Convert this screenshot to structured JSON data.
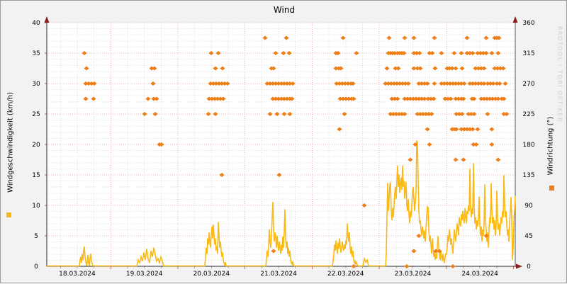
{
  "title": "Wind",
  "watermark": "RRDTOOL / TOBI OETIKER",
  "axes": {
    "left": {
      "label": "Windgeschwindigkeit (km/h)",
      "min": 0,
      "max": 40,
      "ticks": [
        "0",
        "5",
        "10",
        "15",
        "20",
        "25",
        "30",
        "35",
        "40"
      ]
    },
    "right": {
      "label": "Windrichtung (°)",
      "min": 0,
      "max": 360,
      "ticks": [
        "0",
        "45",
        "90",
        "135",
        "180",
        "225",
        "270",
        "315",
        "360"
      ]
    },
    "x": {
      "labels": [
        "18.03.2024",
        "19.03.2024",
        "20.03.2024",
        "21.03.2024",
        "22.03.2024",
        "23.03.2024",
        "24.03.2024"
      ]
    }
  },
  "legend": {
    "speed_marker": "wind-speed",
    "speed_color": "#fbb913",
    "direction_marker": "wind-direction",
    "direction_color": "#ee7e16"
  },
  "colors": {
    "grid_major": "#f2afaf",
    "grid_minor": "#dcdcdc",
    "axis": "#2b2b2b",
    "axis_right": "#555555",
    "arrow": "#8a1d1d",
    "plot_bg": "#ffffff",
    "page_bg": "#f2f2f2",
    "text": "#000000"
  },
  "chart_data": {
    "type": "line+scatter",
    "x_unit": "days since 18.03.2024 00:00",
    "x_range": [
      0.046,
      7.026
    ],
    "ylim_left": [
      0,
      40
    ],
    "ylim_right": [
      0,
      360
    ],
    "grid": "dotted, major every 5 km/h (45 deg) and每 midnight, minor every 1 km/h and 6 h",
    "series": [
      {
        "name": "Windgeschwindigkeit",
        "unit": "km/h",
        "type": "line",
        "color": "#fbb913",
        "segments": [
          {
            "t0": 0.5322,
            "dt": 0.01056,
            "values": [
              0,
              1,
              1.5,
              0.5,
              2,
              1,
              2.5,
              3.2,
              1.5,
              0.8,
              0,
              0.5,
              1.8,
              0.6,
              0,
              1.2,
              2,
              1,
              0.4,
              0
            ]
          },
          {
            "t0": 1.3875,
            "dt": 0.02112,
            "values": [
              0,
              1,
              0.5,
              1.5,
              0.8,
              2.2,
              1,
              2.8,
              1.2,
              0.5,
              2.5,
              1.5,
              3,
              1.8,
              0.8,
              1.2,
              0.5,
              1.5,
              0.8,
              0
            ]
          },
          {
            "t0": 2.4013,
            "dt": 0.01056,
            "values": [
              0,
              1.5,
              3,
              2,
              4.5,
              3.5,
              5.5,
              4,
              3,
              5,
              6.5,
              4.5,
              6.8,
              5,
              3.5,
              4.5,
              2.5,
              3.2,
              2,
              7.2,
              5,
              3,
              4,
              2.5,
              1.5,
              2.2,
              1,
              0.5,
              0.2,
              0.6,
              0
            ]
          },
          {
            "t0": 3.3094,
            "dt": 0.01056,
            "values": [
              0,
              1,
              2.5,
              1.5,
              3,
              6,
              4,
              3,
              5,
              8,
              10.5,
              6,
              4,
              5.5,
              4.5,
              3,
              5,
              3.5,
              2.5,
              4,
              3,
              2,
              3.5,
              2.5,
              4.8,
              3,
              5.5,
              9.3,
              5,
              3,
              4,
              2,
              3,
              1.5,
              2.5,
              1,
              0.5,
              0.3,
              0.8,
              0.2,
              0
            ]
          },
          {
            "t0": 4.302,
            "dt": 0.01056,
            "values": [
              0,
              0.8,
              2,
              3.5,
              2.5,
              4.2,
              3,
              2,
              3.8,
              2.8,
              4.5,
              3.2,
              2.2,
              3,
              4,
              3,
              2.5,
              3.5,
              2.8,
              4.2,
              3.5,
              7,
              5,
              4,
              5.5,
              3,
              2,
              3.2,
              1.5,
              2.5,
              1,
              0.5,
              0.8,
              0.3,
              0.6,
              0.2,
              0
            ]
          },
          {
            "t0": 4.7561,
            "dt": 0.02112,
            "values": [
              0,
              1.2,
              0.6,
              1,
              0
            ]
          },
          {
            "t0": 5.094,
            "dt": 0.01056,
            "values": [
              0,
              2,
              8,
              13.6,
              9,
              11,
              13.4,
              13.6,
              9,
              7.5,
              9.5,
              8,
              10,
              12,
              13,
              11,
              14,
              16.5,
              13,
              15,
              12,
              13.5,
              14.5,
              12.5,
              16.5,
              13,
              14,
              11,
              12.5,
              13.8,
              10,
              9,
              11,
              8.5,
              7,
              9,
              8,
              10,
              12,
              13,
              11,
              9,
              10.5,
              12,
              20.6,
              20.3,
              14,
              9,
              7,
              7.5,
              6,
              5,
              6.5,
              5.5,
              4.5,
              5.8,
              4,
              6,
              8,
              9.8,
              9.5,
              6,
              4,
              5,
              3.5,
              2,
              4.5,
              3,
              1.5,
              2.5,
              1,
              2,
              1.2,
              3,
              4.9,
              3,
              2,
              1,
              2.5,
              1.5,
              0.8,
              2,
              1,
              0.5,
              1.5,
              2
            ]
          },
          {
            "t0": 6.0021,
            "dt": 0.01056,
            "values": [
              2,
              3,
              5,
              4,
              6,
              5,
              3.5,
              4.5,
              3,
              2,
              4,
              6,
              5,
              4,
              5.5,
              7,
              6,
              5,
              8,
              7,
              6.5,
              8.5,
              7.5,
              9,
              8,
              7,
              9.5,
              8,
              7,
              9,
              8.5,
              10,
              9,
              16,
              10,
              8,
              9.5,
              8.5,
              16.9,
              10,
              7,
              8,
              6,
              7.5,
              6.5,
              8,
              11.4,
              7,
              5,
              6.5,
              4,
              6,
              5,
              7,
              13.4,
              8,
              6,
              4,
              5.5,
              3,
              6,
              8,
              7,
              13.6,
              9,
              7,
              8,
              6,
              7.5,
              5,
              6.5,
              12.4,
              8,
              6,
              7,
              5,
              6.5,
              8,
              7,
              9,
              8,
              14.9,
              10,
              8,
              9,
              7,
              5,
              6,
              4,
              7,
              9,
              11.3,
              8,
              1,
              3,
              7,
              9,
              11.5
            ]
          }
        ]
      },
      {
        "name": "Windrichtung",
        "unit": "°",
        "type": "scatter",
        "color": "#ee7e16",
        "levels": [
          {
            "deg": 337.5,
            "t": [
              3.299,
              3.616,
              4.461,
              5.147,
              5.379,
              5.516,
              5.822,
              6.308,
              6.593,
              6.72,
              6.752,
              6.783
            ]
          },
          {
            "deg": 315,
            "t": [
              0.606,
              2.496,
              2.602,
              3.457,
              3.573,
              3.658,
              4.355,
              4.386,
              4.661,
              5.136,
              5.168,
              5.199,
              5.231,
              5.273,
              5.305,
              5.337,
              5.368,
              5.516,
              5.558,
              5.6,
              5.748,
              5.79,
              5.927,
              6.117,
              6.223,
              6.308,
              6.35,
              6.392,
              6.466,
              6.508,
              6.55,
              6.593,
              6.677,
              6.772
            ]
          },
          {
            "deg": 292.5,
            "t": [
              0.638,
              1.609,
              1.651,
              2.56,
              2.665,
              3.394,
              3.425,
              4.355,
              4.397,
              4.429,
              5.115,
              5.242,
              5.284,
              5.516,
              5.569,
              5.611,
              5.832,
              6.012,
              6.044,
              6.086,
              6.139,
              6.234,
              6.434,
              6.477,
              6.519,
              6.561,
              6.72,
              6.762,
              6.804,
              6.847
            ]
          },
          {
            "deg": 270,
            "t": [
              0.627,
              0.669,
              0.712,
              0.754,
              1.63,
              2.486,
              2.528,
              2.57,
              2.613,
              2.655,
              2.697,
              2.739,
              3.331,
              3.373,
              3.415,
              3.457,
              3.499,
              3.542,
              3.584,
              3.626,
              3.668,
              3.711,
              4.365,
              4.408,
              4.45,
              4.492,
              4.534,
              4.577,
              4.608,
              5.094,
              5.136,
              5.178,
              5.221,
              5.263,
              5.305,
              5.347,
              5.39,
              5.432,
              5.59,
              5.632,
              5.675,
              5.717,
              5.822,
              5.927,
              5.97,
              6.012,
              6.054,
              6.097,
              6.139,
              6.181,
              6.223,
              6.266,
              6.35,
              6.392,
              6.434,
              6.477,
              6.519,
              6.561,
              6.614,
              6.656,
              6.698,
              6.752,
              6.794,
              6.878
            ]
          },
          {
            "deg": 247.5,
            "t": [
              0.627,
              0.743,
              1.556,
              1.641,
              1.683,
              2.465,
              2.507,
              2.549,
              2.591,
              2.634,
              2.676,
              3.415,
              3.457,
              3.499,
              3.542,
              3.584,
              3.626,
              3.668,
              3.7,
              4.418,
              4.461,
              4.503,
              4.545,
              4.587,
              4.619,
              5.189,
              5.231,
              5.273,
              5.379,
              5.421,
              5.463,
              5.506,
              5.548,
              5.59,
              5.632,
              5.675,
              5.727,
              5.77,
              5.812,
              5.981,
              6.023,
              6.065,
              6.139,
              6.181,
              6.223,
              6.255,
              6.382,
              6.413,
              6.519,
              6.561,
              6.603,
              6.646,
              6.688,
              6.73,
              6.772,
              6.825,
              6.857
            ]
          },
          {
            "deg": 225,
            "t": [
              1.504,
              1.662,
              2.454,
              2.56,
              3.373,
              3.478,
              3.584,
              3.668,
              4.481,
              5.168,
              5.21,
              5.252,
              5.295,
              5.337,
              5.379,
              5.569,
              5.611,
              5.653,
              5.696,
              5.738,
              5.78,
              6.149,
              6.192,
              6.234,
              6.329,
              6.371,
              6.413,
              6.614,
              6.857,
              6.899
            ]
          },
          {
            "deg": 202.5,
            "t": [
              4.408,
              5.717,
              6.086,
              6.118,
              6.149,
              6.223,
              6.266,
              6.308,
              6.35,
              6.392,
              6.466,
              6.677
            ]
          },
          {
            "deg": 180,
            "t": [
              1.725,
              1.757,
              5.537,
              5.748,
              6.403,
              6.445,
              6.677
            ]
          },
          {
            "deg": 157.5,
            "t": [
              5.463,
              6.139,
              6.255,
              6.772
            ]
          },
          {
            "deg": 135,
            "t": [
              2.655,
              3.51
            ]
          },
          {
            "deg": 90,
            "t": [
              4.777
            ]
          },
          {
            "deg": 45,
            "t": [
              5.59,
              6.593
            ]
          },
          {
            "deg": 22.5,
            "t": [
              3.425,
              5.516,
              5.843,
              5.896
            ]
          },
          {
            "deg": 0,
            "t": [
              4.619,
              5.411,
              6.097
            ]
          }
        ]
      }
    ]
  }
}
